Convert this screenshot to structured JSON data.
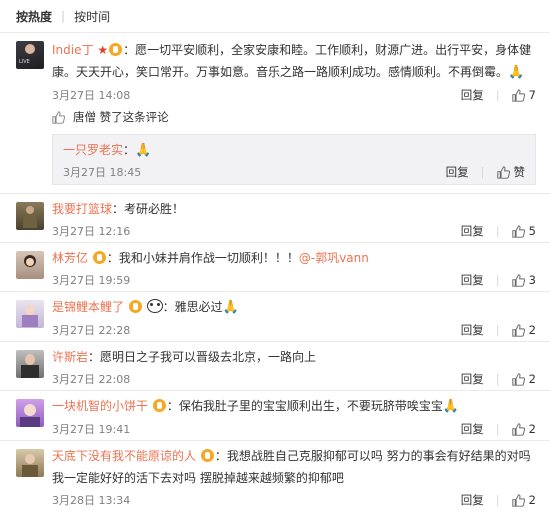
{
  "sort": {
    "hot": "按热度",
    "time": "按时间"
  },
  "actions": {
    "reply": "回复",
    "like_placeholder": "赞"
  },
  "comments": [
    {
      "user": "Indie丁",
      "has_star": true,
      "text": "：愿一切平安顺利，全家安康和睦。工作顺利，财源广进。出行平安，身体健康。天天开心，笑口常开。万事如意。音乐之路一路顺利成功。感情顺利。不再倒霉。",
      "emoji": "🙏",
      "date": "3月27日 14:08",
      "likes": "7",
      "liked_by": "唐僧 赞了这条评论",
      "sub": {
        "user": "一只罗老实",
        "text": "：",
        "emoji": "🙏",
        "date": "3月27日 18:45",
        "likes": "赞"
      }
    },
    {
      "user": "我要打篮球",
      "text": "：考研必胜！",
      "date": "3月27日 12:16",
      "likes": "5"
    },
    {
      "user": "林芳亿",
      "text": "：我和小妹并肩作战一切顺利！！！",
      "mention": "@-郭巩vann",
      "date": "3月27日 19:59",
      "likes": "3"
    },
    {
      "user": "是锦鲤本鲤了",
      "text": "：雅思必过",
      "emoji": "🙏",
      "date": "3月27日 22:28",
      "likes": "2"
    },
    {
      "user": "许斯岩",
      "text": "：愿明日之子我可以晋级去北京，一路向上",
      "date": "3月27日 22:08",
      "likes": "2"
    },
    {
      "user": "一块机智的小饼干",
      "text": "：保佑我肚子里的宝宝顺利出生，不要玩脐带唉宝宝",
      "emoji": "🙏",
      "date": "3月27日 19:41",
      "likes": "2"
    },
    {
      "user": "天底下没有我不能原谅的人",
      "text": "：我想战胜自己克服抑郁可以吗 努力的事会有好结果的对吗 我一定能好好的活下去对吗 摆脱掉越来越频繁的抑郁吧",
      "date": "3月28日 13:34",
      "likes": "2"
    }
  ],
  "colors": {
    "username": "#eb7350",
    "badge": "#f7a823",
    "star": "#e63f2d",
    "sub_bg": "#f2f2f5"
  }
}
